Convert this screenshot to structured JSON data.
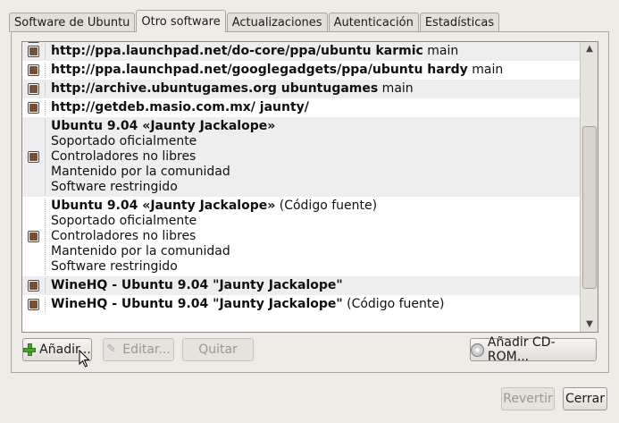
{
  "tabs": [
    "Software de Ubuntu",
    "Otro software",
    "Actualizaciones",
    "Autenticación",
    "Estadísticas"
  ],
  "active_tab": 1,
  "sources": [
    {
      "bold": "http://ppa.launchpad.net/do-core/ppa/ubuntu karmic",
      "normal": " main",
      "checked": true
    },
    {
      "bold": "http://ppa.launchpad.net/googlegadgets/ppa/ubuntu hardy",
      "normal": " main",
      "checked": true
    },
    {
      "bold": "http://archive.ubuntugames.org ubuntugames",
      "normal": " main",
      "checked": true
    },
    {
      "bold": "http://getdeb.masio.com.mx/ jaunty/",
      "normal": "",
      "checked": true
    },
    {
      "bold": "Ubuntu 9.04 «Jaunty Jackalope»",
      "normal": "",
      "lines": [
        "Soportado oficialmente",
        "Controladores no libres",
        "Mantenido por la comunidad",
        "Software restringido"
      ],
      "checked": true
    },
    {
      "bold": "Ubuntu 9.04 «Jaunty Jackalope»",
      "normal": " (Código fuente)",
      "lines": [
        "Soportado oficialmente",
        "Controladores no libres",
        "Mantenido por la comunidad",
        "Software restringido"
      ],
      "checked": true
    },
    {
      "bold": "WineHQ - Ubuntu 9.04 \"Jaunty Jackalope\"",
      "normal": "",
      "checked": true
    },
    {
      "bold": "WineHQ - Ubuntu 9.04 \"Jaunty Jackalope\"",
      "normal": " (Código fuente)",
      "checked": true
    }
  ],
  "buttons": {
    "add": "Añadir...",
    "edit": "Editar...",
    "remove": "Quitar",
    "add_cdrom": "Añadir CD-ROM...",
    "revert": "Revertir",
    "close": "Cerrar"
  }
}
